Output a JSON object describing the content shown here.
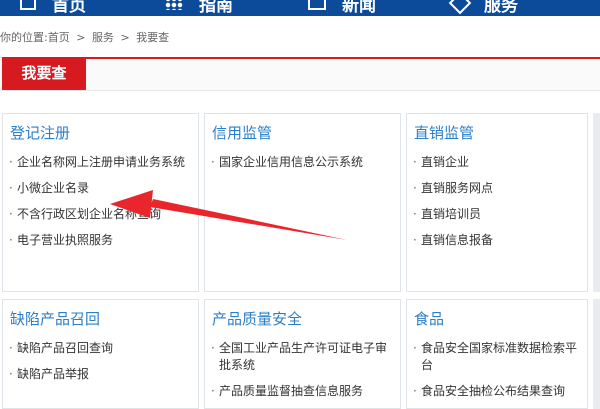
{
  "nav": {
    "items": [
      {
        "label": "首页",
        "icon": "home-icon"
      },
      {
        "label": "指南",
        "icon": "guide-icon"
      },
      {
        "label": "新闻",
        "icon": "news-icon"
      },
      {
        "label": "服务",
        "icon": "service-icon"
      }
    ]
  },
  "breadcrumb": {
    "prefix": "你的位置:首页",
    "sep1": ">",
    "crumb2": "服务",
    "sep2": ">",
    "crumb3": "我要查"
  },
  "page": {
    "title": "我要查"
  },
  "cards": [
    {
      "title": "登记注册",
      "items": [
        "企业名称网上注册申请业务系统",
        "小微企业名录",
        "不含行政区划企业名称查询",
        "电子营业执照服务"
      ]
    },
    {
      "title": "信用监管",
      "items": [
        "国家企业信用信息公示系统"
      ]
    },
    {
      "title": "直销监管",
      "items": [
        "直销企业",
        "直销服务网点",
        "直销培训员",
        "直销信息报备"
      ]
    },
    {
      "title": "缺陷产品召回",
      "items": [
        "缺陷产品召回查询",
        "缺陷产品举报"
      ]
    },
    {
      "title": "产品质量安全",
      "items": [
        "全国工业产品生产许可证电子审批系统",
        "产品质量监督抽查信息服务"
      ]
    },
    {
      "title": "食品",
      "items": [
        "食品安全国家标准数据检索平台",
        "食品安全抽检公布结果查询"
      ]
    }
  ],
  "colors": {
    "nav_bg": "#0b4b9a",
    "accent_red": "#d71920",
    "link_blue": "#2b7fc8",
    "arrow_red": "#e8262b"
  }
}
